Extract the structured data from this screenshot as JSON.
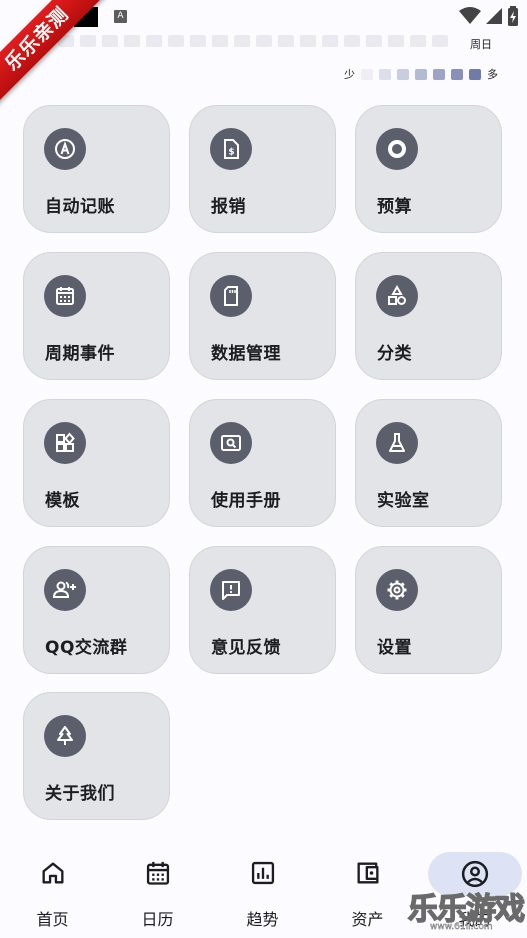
{
  "status_bar": {
    "weekday_label": "周日"
  },
  "ribbon": {
    "text": "乐乐亲测"
  },
  "heatmap": {
    "cells": 18,
    "legend_less": "少",
    "legend_more": "多",
    "legend_colors": [
      "#eeeef4",
      "#dcdfea",
      "#c8cde0",
      "#b3bad4",
      "#9ca5c8",
      "#8791ba",
      "#6f7bab"
    ]
  },
  "tools": [
    {
      "label": "自动记账",
      "icon": "auto-accounting-icon"
    },
    {
      "label": "报销",
      "icon": "reimburse-icon"
    },
    {
      "label": "预算",
      "icon": "budget-icon"
    },
    {
      "label": "周期事件",
      "icon": "calendar-icon"
    },
    {
      "label": "数据管理",
      "icon": "sd-card-icon"
    },
    {
      "label": "分类",
      "icon": "category-icon"
    },
    {
      "label": "模板",
      "icon": "template-icon"
    },
    {
      "label": "使用手册",
      "icon": "manual-icon"
    },
    {
      "label": "实验室",
      "icon": "flask-icon"
    },
    {
      "label": "QQ交流群",
      "icon": "add-group-icon"
    },
    {
      "label": "意见反馈",
      "icon": "feedback-icon"
    },
    {
      "label": "设置",
      "icon": "gear-icon"
    },
    {
      "label": "关于我们",
      "icon": "tree-icon"
    }
  ],
  "nav": [
    {
      "label": "首页",
      "icon": "home-icon"
    },
    {
      "label": "日历",
      "icon": "calendar-icon"
    },
    {
      "label": "趋势",
      "icon": "chart-icon"
    },
    {
      "label": "资产",
      "icon": "wallet-icon"
    },
    {
      "label": "我的",
      "icon": "account-icon",
      "active": true
    }
  ],
  "watermark": {
    "text": "乐乐游戏",
    "url": "www.61ll.com"
  }
}
